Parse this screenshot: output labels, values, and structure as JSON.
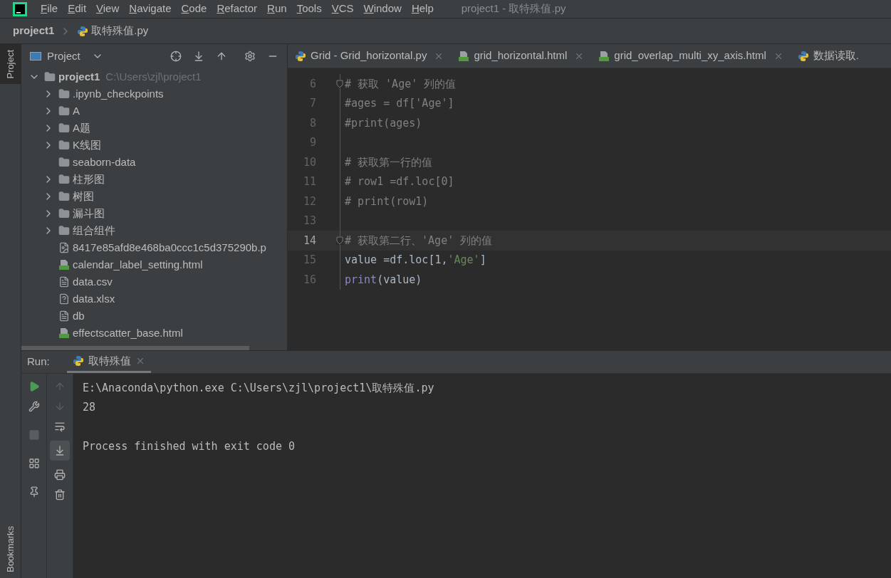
{
  "menu": [
    "File",
    "Edit",
    "View",
    "Navigate",
    "Code",
    "Refactor",
    "Run",
    "Tools",
    "VCS",
    "Window",
    "Help"
  ],
  "window": {
    "title": "project1 - 取特殊值.py"
  },
  "breadcrumb": [
    {
      "label": "project1",
      "kind": "project"
    },
    {
      "label": "取特殊值.py",
      "kind": "python"
    }
  ],
  "side_tabs": [
    {
      "label": "Project",
      "selected": true
    },
    {
      "label": "Bookmarks",
      "selected": false
    }
  ],
  "project_panel": {
    "title": "Project",
    "tree": [
      {
        "label": "project1",
        "path": "C:\\Users\\zjl\\project1",
        "kind": "folder",
        "expanded": true,
        "children": [
          {
            "label": ".ipynb_checkpoints",
            "kind": "folder",
            "expanded": false
          },
          {
            "label": "A",
            "kind": "folder",
            "expanded": false
          },
          {
            "label": "A题",
            "kind": "folder",
            "expanded": false
          },
          {
            "label": "K线图",
            "kind": "folder",
            "expanded": false
          },
          {
            "label": "seaborn-data",
            "kind": "folder"
          },
          {
            "label": "柱形图",
            "kind": "folder",
            "expanded": false
          },
          {
            "label": "树图",
            "kind": "folder",
            "expanded": false
          },
          {
            "label": "漏斗图",
            "kind": "folder",
            "expanded": false
          },
          {
            "label": "组合组件",
            "kind": "folder",
            "expanded": false
          },
          {
            "label": "8417e85afd8e468ba0ccc1c5d375290b.p",
            "kind": "image"
          },
          {
            "label": "calendar_label_setting.html",
            "kind": "html"
          },
          {
            "label": "data.csv",
            "kind": "text"
          },
          {
            "label": "data.xlsx",
            "kind": "unknown"
          },
          {
            "label": "db",
            "kind": "text"
          },
          {
            "label": "effectscatter_base.html",
            "kind": "html"
          }
        ]
      }
    ]
  },
  "editor_tabs": [
    {
      "label": "Grid - Grid_horizontal.py",
      "kind": "python",
      "selected": false
    },
    {
      "label": "grid_horizontal.html",
      "kind": "html",
      "selected": false
    },
    {
      "label": "grid_overlap_multi_xy_axis.html",
      "kind": "html",
      "selected": false
    },
    {
      "label": "数据读取.",
      "kind": "python",
      "selected": false
    }
  ],
  "code_lines": [
    {
      "number": "6",
      "current": false,
      "fold": true,
      "tokens": [
        {
          "text": "# 获取 'Age' 列的值",
          "kind": "comment"
        }
      ]
    },
    {
      "number": "7",
      "current": false,
      "tokens": [
        {
          "text": "#ages = df['Age']",
          "kind": "comment"
        }
      ]
    },
    {
      "number": "8",
      "current": false,
      "tokens": [
        {
          "text": "#print(ages)",
          "kind": "comment"
        }
      ]
    },
    {
      "number": "9",
      "current": false
    },
    {
      "number": "10",
      "current": false,
      "tokens": [
        {
          "text": "# 获取第一行的值",
          "kind": "comment"
        }
      ]
    },
    {
      "number": "11",
      "current": false,
      "tokens": [
        {
          "text": "# row1 =df.loc[0]",
          "kind": "comment"
        }
      ]
    },
    {
      "number": "12",
      "current": false,
      "tokens": [
        {
          "text": "# print(row1)",
          "kind": "comment"
        }
      ]
    },
    {
      "number": "13",
      "current": false
    },
    {
      "number": "14",
      "current": true,
      "fold": true,
      "tokens": [
        {
          "text": "# 获取第二行、'Age' 列的值",
          "kind": "comment"
        }
      ]
    },
    {
      "number": "15",
      "current": false,
      "tokens": [
        {
          "text": "value =df.loc[1,",
          "kind": "plain"
        },
        {
          "text": "'Age'",
          "kind": "string"
        },
        {
          "text": "]",
          "kind": "plain"
        }
      ]
    },
    {
      "number": "16",
      "current": false,
      "tokens": [
        {
          "text": "print",
          "kind": "builtin"
        },
        {
          "text": "(value)",
          "kind": "plain"
        }
      ]
    }
  ],
  "run_panel": {
    "label": "Run:",
    "tab": "取特殊值",
    "output_blocks": [
      [
        "E:\\Anaconda\\python.exe C:\\Users\\zjl\\project1\\取特殊值.py",
        "28"
      ],
      [
        "Process finished with exit code 0"
      ]
    ]
  }
}
